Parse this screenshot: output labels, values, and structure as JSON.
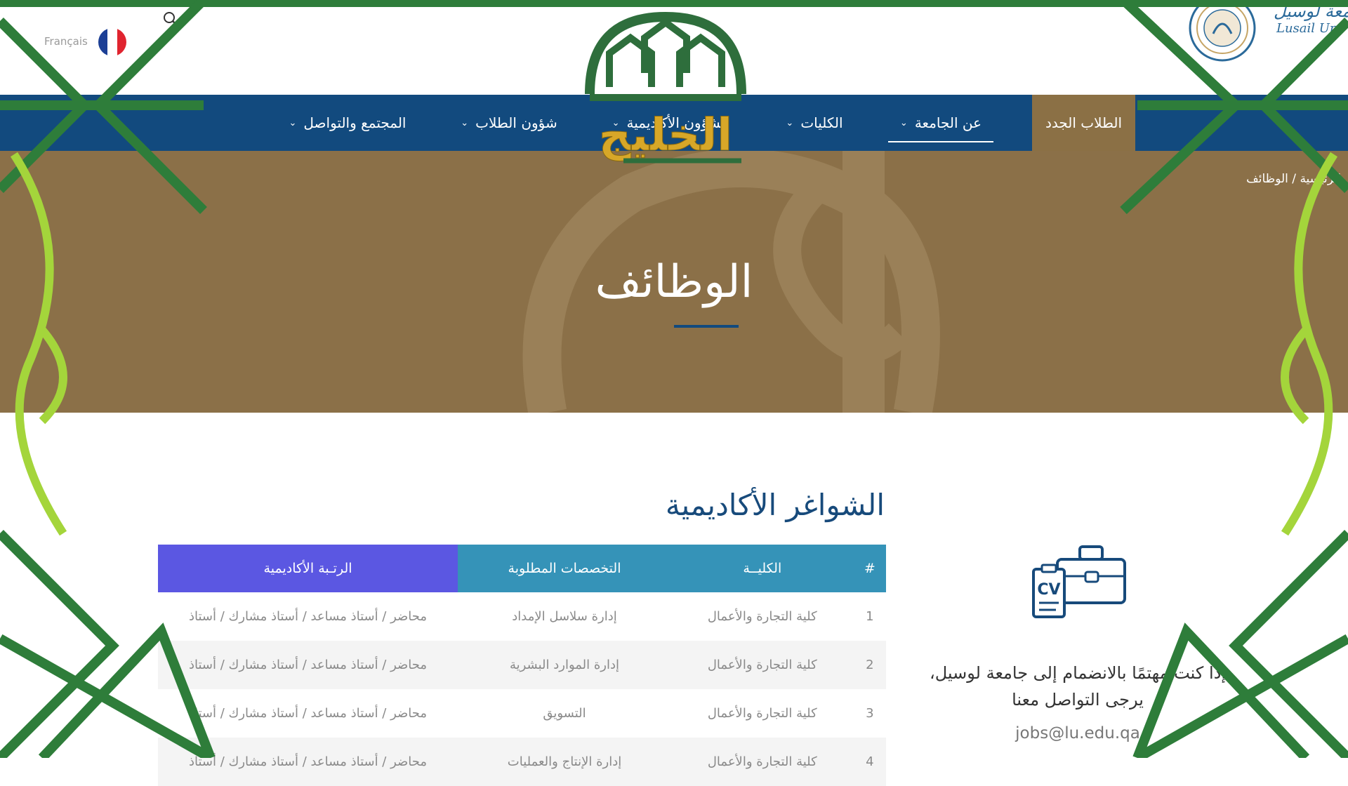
{
  "header": {
    "language_label": "Français",
    "university_name": "جامعة لوسيل",
    "university_sub": "Lusail Uni"
  },
  "nav": {
    "items": [
      {
        "label": "الطلاب الجدد",
        "active": true
      },
      {
        "label": "عن الجامعة",
        "has_dropdown": true
      },
      {
        "label": "الكليات",
        "has_dropdown": true
      },
      {
        "label": "الشؤون الأكاديمية",
        "has_dropdown": true
      },
      {
        "label": "شؤون الطلاب",
        "has_dropdown": true
      },
      {
        "label": "المجتمع والتواصل",
        "has_dropdown": true
      }
    ]
  },
  "breadcrumb": {
    "home": "الرئيسية",
    "separator": "/",
    "current": "الوظائف"
  },
  "hero": {
    "title": "الوظائف"
  },
  "section": {
    "title": "الشواغر الأكاديمية"
  },
  "table": {
    "headers": [
      "#",
      "الكليــة",
      "التخصصات المطلوبة",
      "الرتـبة الأكاديمية"
    ],
    "rows": [
      [
        "1",
        "كلية التجارة والأعمال",
        "إدارة سلاسل الإمداد",
        "محاضر / أستاذ مساعد / أستاذ مشارك / أستاذ"
      ],
      [
        "2",
        "كلية التجارة والأعمال",
        "إدارة الموارد البشرية",
        "محاضر / أستاذ مساعد / أستاذ مشارك / أستاذ"
      ],
      [
        "3",
        "كلية التجارة والأعمال",
        "التسويق",
        "محاضر / أستاذ مساعد / أستاذ مشارك / أستاذ"
      ],
      [
        "4",
        "كلية التجارة والأعمال",
        "إدارة الإنتاج والعمليات",
        "محاضر / أستاذ مساعد / أستاذ مشارك / أستاذ"
      ]
    ]
  },
  "contact": {
    "line1": "إذا كنت مهتمًا بالانضمام إلى جامعة لوسيل،",
    "line2": "يرجى التواصل معنا",
    "email": "jobs@lu.edu.qa",
    "cv_label": "CV"
  },
  "watermark": {
    "logo_text": "الخليج"
  },
  "colors": {
    "nav_blue": "#124a7e",
    "hero_brown": "#8b7048",
    "active_tab": "#8b7045",
    "table_header_teal": "#3593b8",
    "table_header_purple": "#5b57e2",
    "frame_green": "#2e7d3a",
    "frame_lime": "#a4d53b"
  },
  "icons": [
    "search-icon",
    "france-flag-icon",
    "chevron-down-icon",
    "cv-briefcase-icon"
  ]
}
